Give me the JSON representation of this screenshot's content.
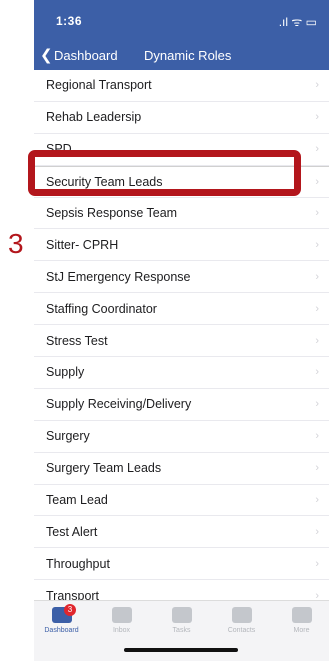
{
  "status_bar": {
    "time": "1:36",
    "icons": ".ıl ᯤ ▭"
  },
  "nav": {
    "back_label": "Dashboard",
    "title": "Dynamic Roles"
  },
  "list_items": [
    "Regional Transport",
    "Rehab Leadersip",
    "SPD",
    "Security Team Leads",
    "Sepsis Response Team",
    "Sitter- CPRH",
    "StJ Emergency Response",
    "Staffing Coordinator",
    "Stress Test",
    "Supply",
    "Supply Receiving/Delivery",
    "Surgery",
    "Surgery Team Leads",
    "Team Lead",
    "Test Alert",
    "Throughput",
    "Transport"
  ],
  "annotation": {
    "step_number": "3",
    "highlight_color": "#b3161c"
  },
  "tabs": [
    {
      "label": "Dashboard",
      "icon": "grid-icon",
      "badge": "3",
      "active": true
    },
    {
      "label": "Inbox",
      "icon": "inbox-icon",
      "badge": "",
      "active": false
    },
    {
      "label": "Tasks",
      "icon": "chat-icon",
      "badge": "",
      "active": false
    },
    {
      "label": "Contacts",
      "icon": "people-icon",
      "badge": "",
      "active": false
    },
    {
      "label": "More",
      "icon": "person-icon",
      "badge": "",
      "active": false
    }
  ],
  "colors": {
    "brand": "#3c5fa7",
    "badge": "#e0262d"
  }
}
